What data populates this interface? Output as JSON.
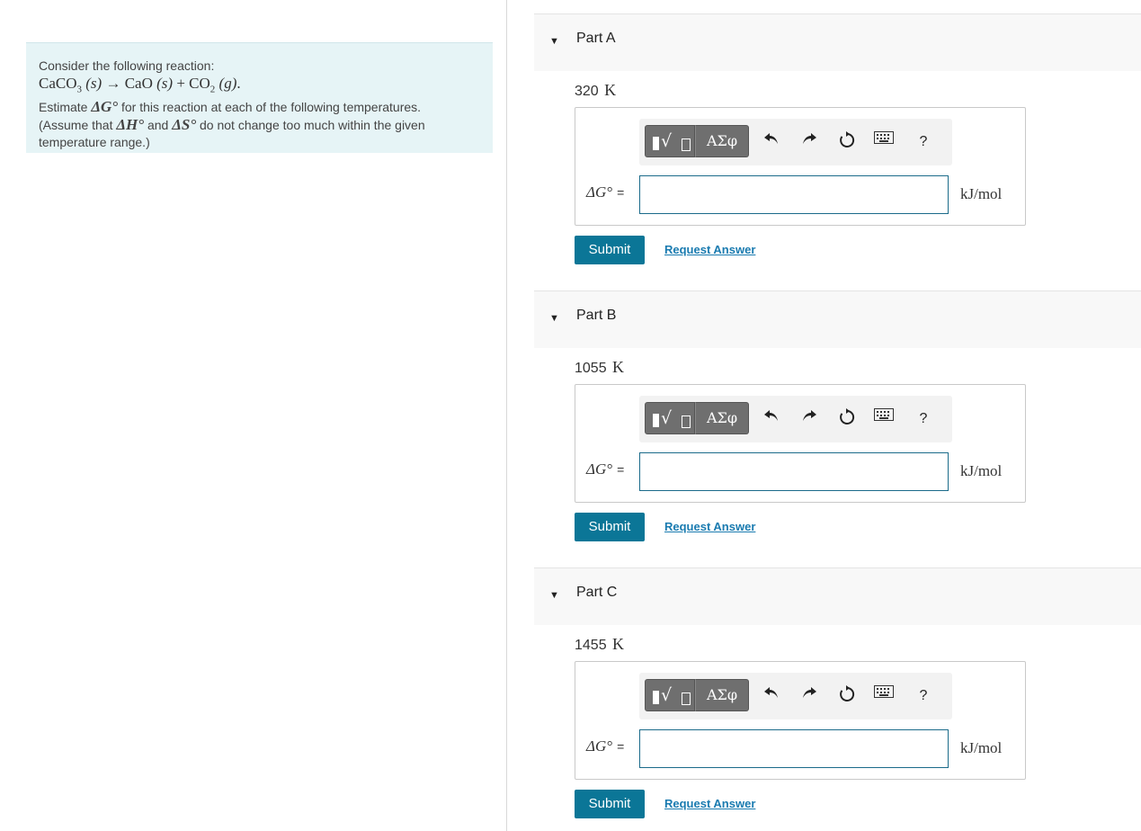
{
  "problem": {
    "intro_text": "Consider the following reaction:",
    "reaction": {
      "reactant": "CaCO",
      "reactant_sub": "3",
      "reactant_state": "(s)",
      "arrow": "→",
      "product1": "CaO",
      "product1_state": "(s)",
      "plus": "+",
      "product2": "CO",
      "product2_sub": "2",
      "product2_state": "(g)",
      "end": "."
    },
    "line2_a": "Estimate ",
    "line2_sym": "ΔG°",
    "line2_b": " for this reaction at each of the following temperatures.",
    "line3_a": "(Assume that ",
    "line3_sym1": "ΔH°",
    "line3_b": " and ",
    "line3_sym2": "ΔS°",
    "line3_c": " do not change too much within the given temperature range.)"
  },
  "toolbar": {
    "greek_label": "ΑΣφ",
    "help_label": "?"
  },
  "parts": [
    {
      "title": "Part A",
      "temperature_value": "320",
      "temperature_unit": "K",
      "delta_g_label": "ΔG°",
      "equals": "=",
      "answer_value": "",
      "unit": "kJ/mol",
      "submit_label": "Submit",
      "request_label": "Request Answer"
    },
    {
      "title": "Part B",
      "temperature_value": "1055",
      "temperature_unit": "K",
      "delta_g_label": "ΔG°",
      "equals": "=",
      "answer_value": "",
      "unit": "kJ/mol",
      "submit_label": "Submit",
      "request_label": "Request Answer"
    },
    {
      "title": "Part C",
      "temperature_value": "1455",
      "temperature_unit": "K",
      "delta_g_label": "ΔG°",
      "equals": "=",
      "answer_value": "",
      "unit": "kJ/mol",
      "submit_label": "Submit",
      "request_label": "Request Answer"
    }
  ]
}
